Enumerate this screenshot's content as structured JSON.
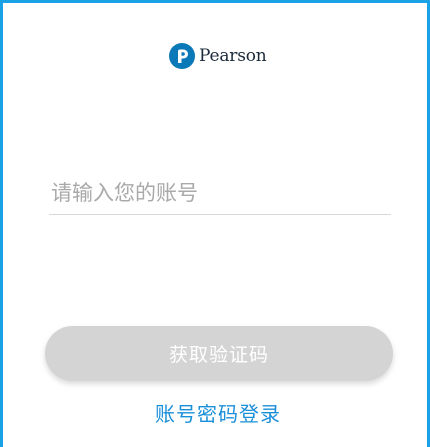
{
  "brand": {
    "name": "Pearson",
    "logo_icon": "pearson-p-icon",
    "logo_color": "#0b79b7"
  },
  "login_form": {
    "account_placeholder": "请输入您的账号",
    "account_value": "",
    "get_code_label": "获取验证码",
    "password_login_label": "账号密码登录"
  },
  "colors": {
    "accent": "#1aa1e6",
    "link": "#1a8fd9",
    "button_disabled": "#d4d4d4"
  }
}
